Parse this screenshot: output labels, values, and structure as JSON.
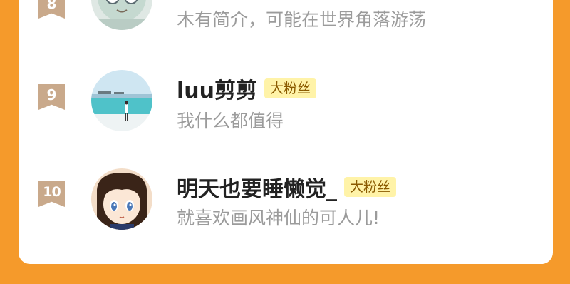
{
  "rows": [
    {
      "rank": "8",
      "name": "",
      "badge": "",
      "desc": "木有简介，可能在世界角落游荡"
    },
    {
      "rank": "9",
      "name": "luu剪剪",
      "badge": "大粉丝",
      "desc": "我什么都值得"
    },
    {
      "rank": "10",
      "name": "明天也要睡懒觉_",
      "badge": "大粉丝",
      "desc": "就喜欢画风神仙的可人儿!"
    }
  ],
  "colors": {
    "background": "#f59a2b",
    "card": "#ffffff",
    "rank_badge": "#c9a98b",
    "fan_badge_bg": "#fff3a8",
    "fan_badge_text": "#8a5a00",
    "name": "#222222",
    "desc": "#9b9b9b"
  }
}
